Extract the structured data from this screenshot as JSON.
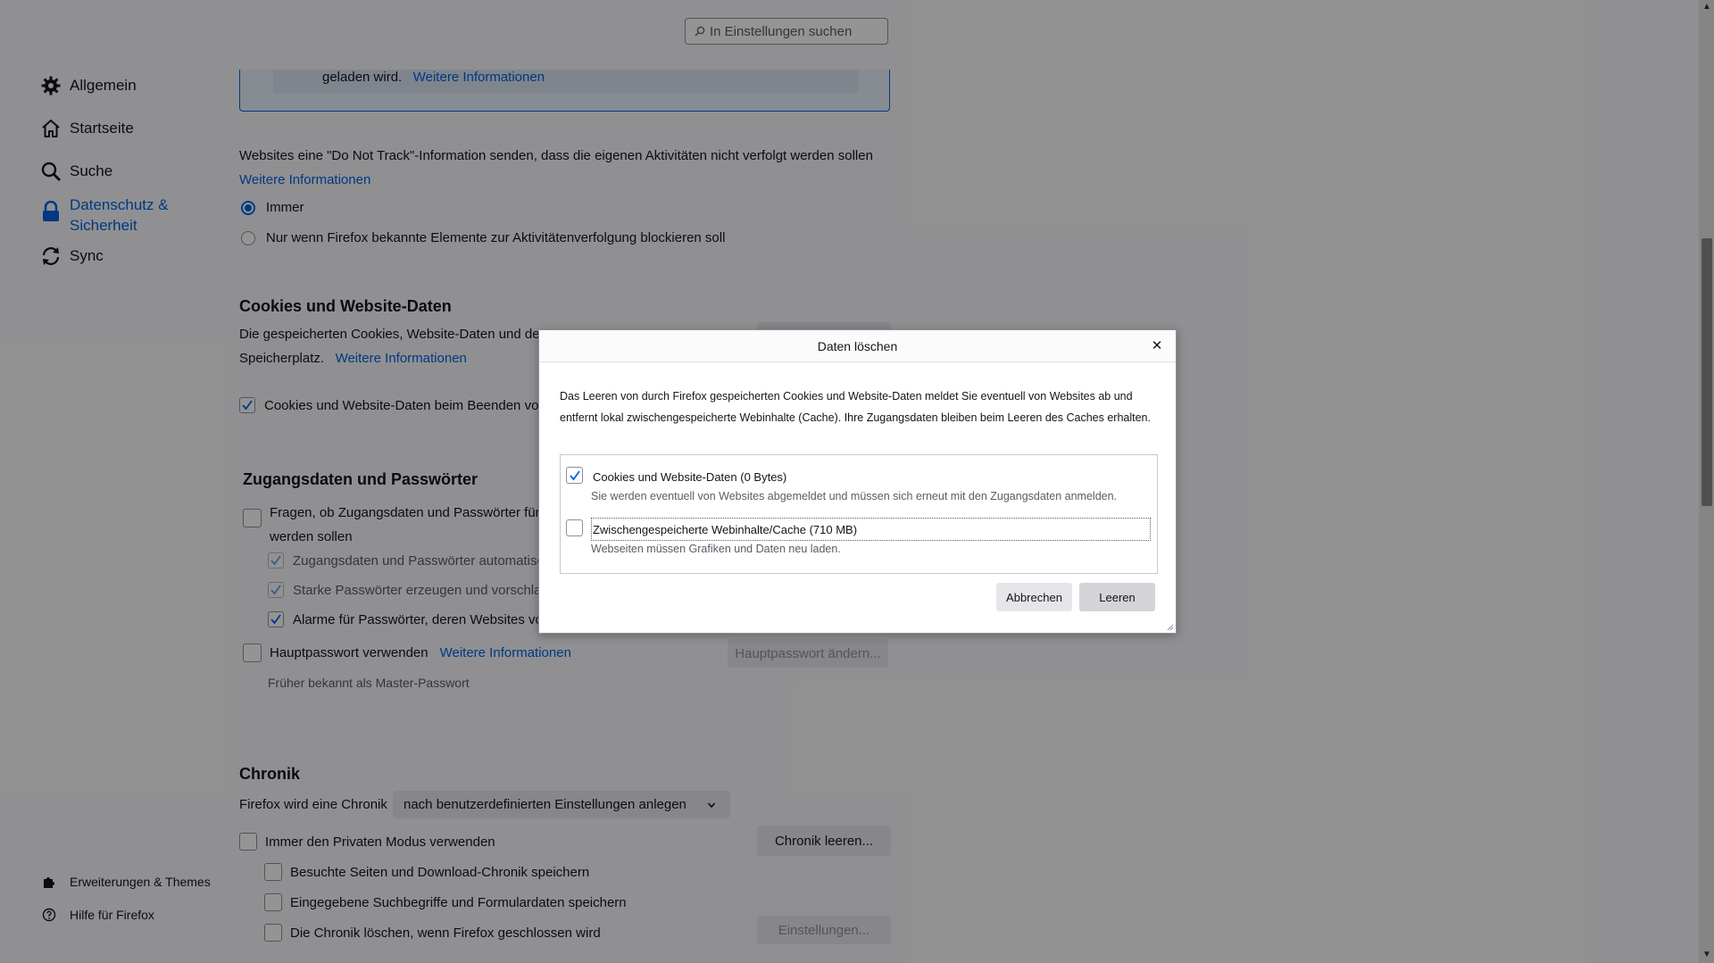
{
  "search": {
    "placeholder": "In Einstellungen suchen"
  },
  "sidebar": {
    "items": [
      {
        "label": "Allgemein",
        "icon": "gear-icon"
      },
      {
        "label": "Startseite",
        "icon": "home-icon"
      },
      {
        "label": "Suche",
        "icon": "search-icon"
      },
      {
        "label": "Datenschutz &\nSicherheit",
        "label_line1": "Datenschutz &",
        "label_line2": "Sicherheit",
        "icon": "lock-icon",
        "active": true
      },
      {
        "label": "Sync",
        "icon": "sync-icon"
      }
    ],
    "footer": [
      {
        "label": "Erweiterungen & Themes",
        "icon": "puzzle-icon"
      },
      {
        "label": "Hilfe für Firefox",
        "icon": "help-icon"
      }
    ]
  },
  "banner": {
    "text": "geladen wird.",
    "link": "Weitere Informationen"
  },
  "dnt": {
    "text": "Websites eine \"Do Not Track\"-Information senden, dass die eigenen Aktivitäten nicht verfolgt werden sollen",
    "link": "Weitere Informationen",
    "option_always": "Immer",
    "option_only": "Nur wenn Firefox bekannte Elemente zur Aktivitätenverfolgung blockieren soll"
  },
  "cookies": {
    "heading": "Cookies und Website-Daten",
    "desc_line1": "Die gespeicherten Cookies, Website-Daten und de",
    "desc_line2": "Speicherplatz.",
    "link": "Weitere Informationen",
    "checkbox_label": "Cookies und Website-Daten beim Beenden vo"
  },
  "passwords": {
    "heading": "Zugangsdaten und Passwörter",
    "ask_line1": "Fragen, ob Zugangsdaten und Passwörter für W",
    "ask_line2": "werden sollen",
    "autofill": "Zugangsdaten und Passwörter automatisc",
    "strong": "Starke Passwörter erzeugen und vorschlag",
    "alerts": "Alarme für Passwörter, deren Websites vo",
    "master_label": "Hauptpasswort verwenden",
    "master_link": "Weitere Informationen",
    "master_button": "Hauptpasswort ändern...",
    "master_note": "Früher bekannt als Master-Passwort"
  },
  "history": {
    "heading": "Chronik",
    "label": "Firefox wird eine Chronik",
    "select_value": "nach benutzerdefinierten Einstellungen anlegen",
    "clear_button": "Chronik leeren...",
    "private": "Immer den Privaten Modus verwenden",
    "visited": "Besuchte Seiten und Download-Chronik speichern",
    "search_forms": "Eingegebene Suchbegriffe und Formulardaten speichern",
    "clear_on_close": "Die Chronik löschen, wenn Firefox geschlossen wird",
    "settings_button": "Einstellungen..."
  },
  "dialog": {
    "title": "Daten löschen",
    "close": "✕",
    "desc": "Das Leeren von durch Firefox gespeicherten Cookies und Website-Daten meldet Sie eventuell von Websites ab und entfernt lokal zwischengespeicherte Webinhalte (Cache). Ihre Zugangsdaten bleiben beim Leeren des Caches erhalten.",
    "opt_cookies_label": "Cookies und Website-Daten (0 Bytes)",
    "opt_cookies_sub": "Sie werden eventuell von Websites abgemeldet und müssen sich erneut mit den Zugangsdaten anmelden.",
    "opt_cache_label": "Zwischengespeicherte Webinhalte/Cache (710 MB)",
    "opt_cache_sub": "Webseiten müssen Grafiken und Daten neu laden.",
    "cancel": "Abbrechen",
    "confirm": "Leeren"
  },
  "colors": {
    "accent": "#0061e0",
    "overlay": "rgba(0,0,0,0.42)"
  }
}
